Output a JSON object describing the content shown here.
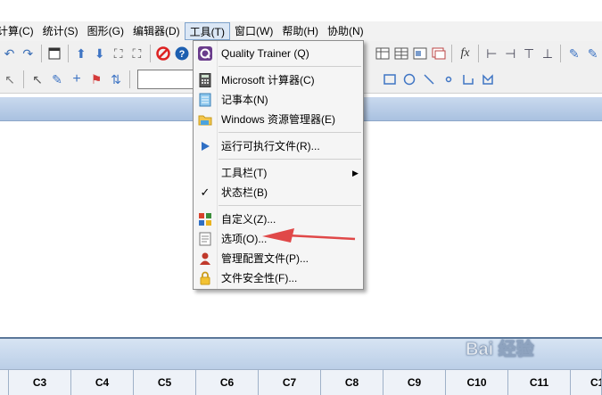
{
  "menubar": {
    "items": [
      "计算(C)",
      "统计(S)",
      "图形(G)",
      "编辑器(D)",
      "工具(T)",
      "窗口(W)",
      "帮助(H)",
      "协助(N)"
    ],
    "first_label_visible": "计算(C)",
    "active_index": 4
  },
  "tools_menu": {
    "items": [
      {
        "label": "Quality Trainer (Q)",
        "icon": "quality-trainer-icon"
      },
      {
        "label": "Microsoft 计算器(C)",
        "icon": "calculator-icon"
      },
      {
        "label": "记事本(N)",
        "icon": "notepad-icon"
      },
      {
        "label": "Windows 资源管理器(E)",
        "icon": "explorer-folder-icon"
      },
      {
        "label": "运行可执行文件(R)...",
        "icon": "run-triangle-icon"
      },
      {
        "label": "工具栏(T)",
        "icon": "",
        "submenu": true
      },
      {
        "label": "状态栏(B)",
        "icon": "checkmark-icon"
      },
      {
        "label": "自定义(Z)...",
        "icon": "customize-grid-icon"
      },
      {
        "label": "选项(O)...",
        "icon": "options-document-icon"
      },
      {
        "label": "管理配置文件(P)...",
        "icon": "profile-person-icon"
      },
      {
        "label": "文件安全性(F)...",
        "icon": "lock-icon"
      }
    ]
  },
  "worksheet": {
    "columns": [
      "C3",
      "C4",
      "C5",
      "C6",
      "C7",
      "C8",
      "C9",
      "C10",
      "C11",
      "C1"
    ]
  },
  "watermark": {
    "text": "Bai 经验"
  },
  "colors": {
    "menu_bg": "#f5f5f5",
    "titlebar": "#b9cde6",
    "annotation_arrow": "#e04848"
  }
}
